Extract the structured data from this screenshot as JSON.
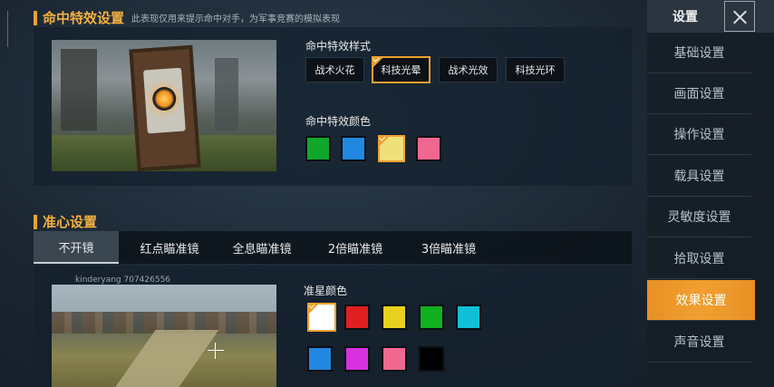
{
  "hit_effect": {
    "title": "命中特效设置",
    "subtitle": "此表现仅用来提示命中对手，为军事竞赛的模拟表现",
    "style_label": "命中特效样式",
    "styles": [
      "战术火花",
      "科技光晕",
      "战术光效",
      "科技光环"
    ],
    "selected_style": "科技光晕",
    "color_label": "命中特效颜色",
    "colors": [
      "#0fa72a",
      "#2088e0",
      "#f0e07a",
      "#f06890"
    ],
    "selected_color_index": 2
  },
  "crosshair": {
    "title": "准心设置",
    "tabs": [
      "不开镜",
      "红点瞄准镜",
      "全息瞄准镜",
      "2倍瞄准镜",
      "3倍瞄准镜"
    ],
    "active_tab": "不开镜",
    "watermark": "kinderyang 707426556",
    "color_label": "准星颜色",
    "colors": [
      "#ffffff",
      "#e02020",
      "#e8d020",
      "#10b020",
      "#10c0d8",
      "#2088e0",
      "#d830e0",
      "#f06890",
      "#000000"
    ],
    "selected_color_index": 0
  },
  "sidebar": {
    "title": "设置",
    "items": [
      "基础设置",
      "画面设置",
      "操作设置",
      "载具设置",
      "灵敏度设置",
      "拾取设置",
      "效果设置",
      "声音设置"
    ],
    "active_item": "效果设置"
  }
}
